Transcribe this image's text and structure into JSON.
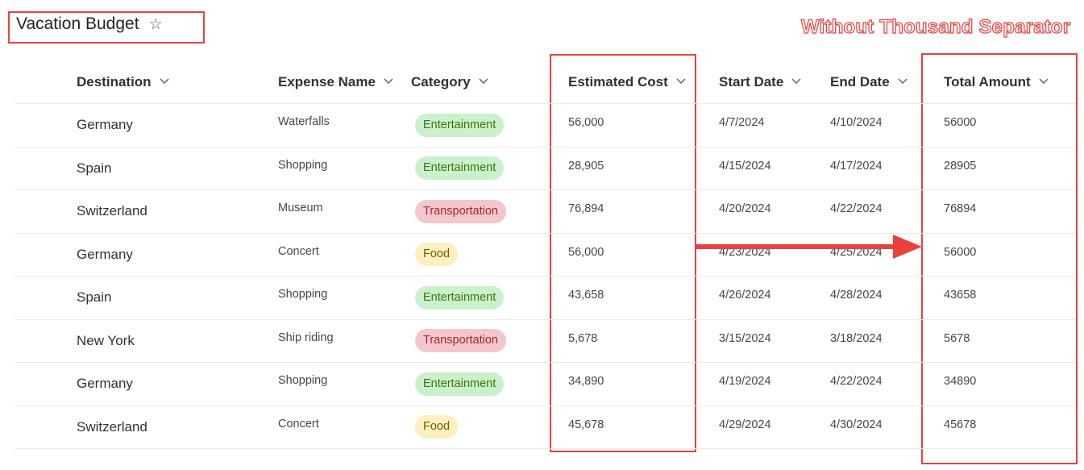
{
  "list": {
    "title": "Vacation Budget"
  },
  "annotation": {
    "text": "Without Thousand Separator"
  },
  "columns": [
    {
      "key": "destination",
      "label": "Destination"
    },
    {
      "key": "expense",
      "label": "Expense Name"
    },
    {
      "key": "category",
      "label": "Category"
    },
    {
      "key": "estimated",
      "label": "Estimated Cost"
    },
    {
      "key": "start",
      "label": "Start Date"
    },
    {
      "key": "end",
      "label": "End Date"
    },
    {
      "key": "total",
      "label": "Total Amount"
    }
  ],
  "rows": [
    {
      "destination": "Germany",
      "expense": "Waterfalls",
      "category": "Entertainment",
      "estimated": "56,000",
      "start": "4/7/2024",
      "end": "4/10/2024",
      "total": "56000"
    },
    {
      "destination": "Spain",
      "expense": "Shopping",
      "category": "Entertainment",
      "estimated": "28,905",
      "start": "4/15/2024",
      "end": "4/17/2024",
      "total": "28905"
    },
    {
      "destination": "Switzerland",
      "expense": "Museum",
      "category": "Transportation",
      "estimated": "76,894",
      "start": "4/20/2024",
      "end": "4/22/2024",
      "total": "76894"
    },
    {
      "destination": "Germany",
      "expense": "Concert",
      "category": "Food",
      "estimated": "56,000",
      "start": "4/23/2024",
      "end": "4/25/2024",
      "total": "56000"
    },
    {
      "destination": "Spain",
      "expense": "Shopping",
      "category": "Entertainment",
      "estimated": "43,658",
      "start": "4/26/2024",
      "end": "4/28/2024",
      "total": "43658"
    },
    {
      "destination": "New York",
      "expense": "Ship riding",
      "category": "Transportation",
      "estimated": "5,678",
      "start": "3/15/2024",
      "end": "3/18/2024",
      "total": "5678"
    },
    {
      "destination": "Germany",
      "expense": "Shopping",
      "category": "Entertainment",
      "estimated": "34,890",
      "start": "4/19/2024",
      "end": "4/22/2024",
      "total": "34890"
    },
    {
      "destination": "Switzerland",
      "expense": "Concert",
      "category": "Food",
      "estimated": "45,678",
      "start": "4/29/2024",
      "end": "4/30/2024",
      "total": "45678"
    }
  ],
  "category_colors": {
    "Entertainment": {
      "bg": "#caf0cc",
      "fg": "#437406"
    },
    "Transportation": {
      "bg": "#f4c7cc",
      "fg": "#a4262c"
    },
    "Food": {
      "bg": "#fcefc0",
      "fg": "#7a5c00"
    }
  },
  "colors": {
    "highlight": "#e8413e"
  }
}
